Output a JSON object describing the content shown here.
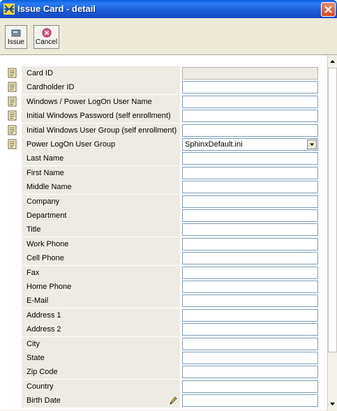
{
  "window": {
    "title": "Issue Card - detail"
  },
  "toolbar": {
    "issue_label": "Issue",
    "cancel_label": "Cancel"
  },
  "fields": [
    {
      "label": "Card ID",
      "value": "",
      "has_icon": true,
      "readonly": true
    },
    {
      "label": "Cardholder ID",
      "value": "",
      "has_icon": true
    },
    {
      "label": "Windows / Power LogOn User Name",
      "value": "",
      "has_icon": true
    },
    {
      "label": "Initial Windows Password (self enrollment)",
      "value": "",
      "has_icon": true
    },
    {
      "label": "Initial Windows User Group (self enrollment)",
      "value": "",
      "has_icon": true
    },
    {
      "label": "Power LogOn User Group",
      "value": "SphinxDefault.ini",
      "has_icon": true,
      "type": "select"
    },
    {
      "label": "Last Name",
      "value": ""
    },
    {
      "label": "First Name",
      "value": ""
    },
    {
      "label": "Middle Name",
      "value": ""
    },
    {
      "label": "Company",
      "value": ""
    },
    {
      "label": "Department",
      "value": ""
    },
    {
      "label": "Title",
      "value": ""
    },
    {
      "label": "Work Phone",
      "value": ""
    },
    {
      "label": "Cell Phone",
      "value": ""
    },
    {
      "label": "Fax",
      "value": ""
    },
    {
      "label": "Home Phone",
      "value": ""
    },
    {
      "label": "E-Mail",
      "value": ""
    },
    {
      "label": "Address 1",
      "value": ""
    },
    {
      "label": "Address 2",
      "value": ""
    },
    {
      "label": "City",
      "value": ""
    },
    {
      "label": "State",
      "value": ""
    },
    {
      "label": "Zip Code",
      "value": ""
    },
    {
      "label": "Country",
      "value": ""
    },
    {
      "label": "Birth Date",
      "value": "",
      "has_edit_button": true
    }
  ],
  "colors": {
    "title_bar": "#1d5fd8",
    "label_bg": "#edebe3",
    "field_border": "#7f9db9"
  }
}
